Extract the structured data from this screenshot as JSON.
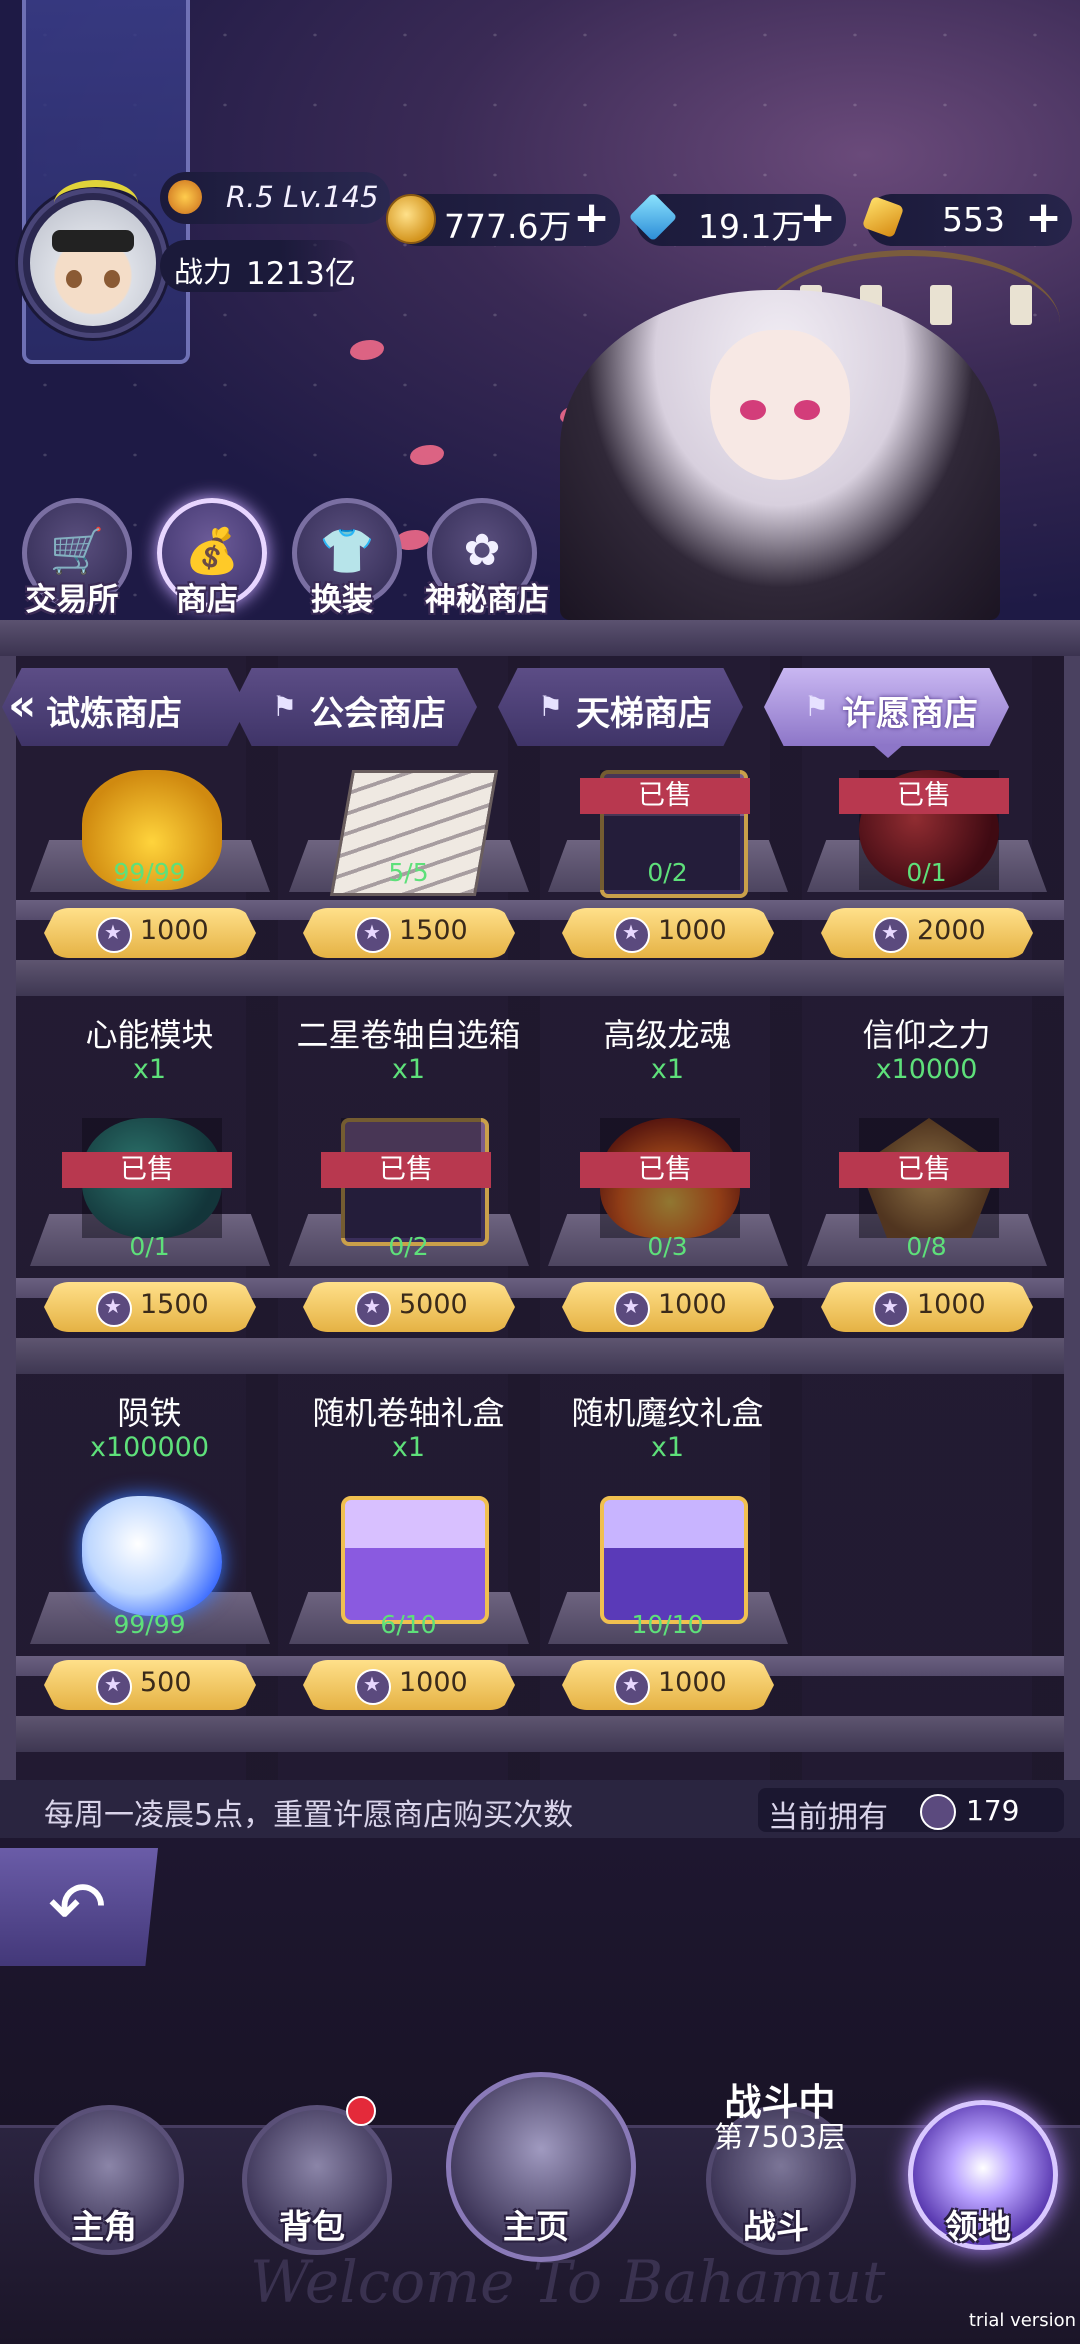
{
  "player": {
    "level": "R.5 Lv.145",
    "power_label": "战力",
    "power_value": "1213亿"
  },
  "currencies": [
    {
      "icon": "gold-coin-icon",
      "value": "777.6万"
    },
    {
      "icon": "blue-diamond-icon",
      "value": "19.1万"
    },
    {
      "icon": "gold-gem-icon",
      "value": "553"
    }
  ],
  "shop_buttons": [
    {
      "label": "交易所",
      "icon": "cart-icon"
    },
    {
      "label": "商店",
      "icon": "money-bag-icon",
      "active": true
    },
    {
      "label": "换装",
      "icon": "shirt-icon"
    },
    {
      "label": "神秘商店",
      "icon": "mystery-bag-icon"
    }
  ],
  "tabs": [
    "试炼商店",
    "公会商店",
    "天梯商店",
    "许愿商店"
  ],
  "sold_label": "已售",
  "rows": [
    {
      "items": [
        {
          "name": "",
          "qty": "",
          "stock": "99/99",
          "price": "1000",
          "sold": false,
          "art": "bag"
        },
        {
          "name": "",
          "qty": "",
          "stock": "5/5",
          "price": "1500",
          "sold": false,
          "art": "cards"
        },
        {
          "name": "",
          "qty": "",
          "stock": "0/2",
          "price": "1000",
          "sold": true,
          "art": "chest"
        },
        {
          "name": "",
          "qty": "",
          "stock": "0/1",
          "price": "2000",
          "sold": true,
          "art": "orb-red"
        }
      ]
    },
    {
      "items": [
        {
          "name": "心能模块",
          "qty": "x1",
          "stock": "0/1",
          "price": "1500",
          "sold": true,
          "art": "orb-teal"
        },
        {
          "name": "二星卷轴自选箱",
          "qty": "x1",
          "stock": "0/2",
          "price": "5000",
          "sold": true,
          "art": "chest"
        },
        {
          "name": "高级龙魂",
          "qty": "x1",
          "stock": "0/3",
          "price": "1000",
          "sold": true,
          "art": "fire"
        },
        {
          "name": "信仰之力",
          "qty": "x10000",
          "stock": "0/8",
          "price": "1000",
          "sold": true,
          "art": "emblem"
        }
      ]
    },
    {
      "items": [
        {
          "name": "陨铁",
          "qty": "x100000",
          "stock": "99/99",
          "price": "500",
          "sold": false,
          "art": "ore"
        },
        {
          "name": "随机卷轴礼盒",
          "qty": "x1",
          "stock": "6/10",
          "price": "1000",
          "sold": false,
          "art": "giftbox"
        },
        {
          "name": "随机魔纹礼盒",
          "qty": "x1",
          "stock": "10/10",
          "price": "1000",
          "sold": false,
          "art": "giftbox2"
        }
      ]
    }
  ],
  "info": {
    "tip": "每周一凌晨5点，重置许愿商店购买次数",
    "own_label": "当前拥有",
    "own_value": "179"
  },
  "nav": [
    {
      "label": "主角"
    },
    {
      "label": "背包"
    },
    {
      "label": "主页"
    },
    {
      "label": "战斗"
    },
    {
      "label": "领地",
      "active": true
    }
  ],
  "battle": {
    "status": "战斗中",
    "floor": "第7503层"
  },
  "watermark": "Welcome To Bahamut",
  "trial": "trial version",
  "colors": {
    "price_gold": "#e5b244",
    "stock_green": "#5ee07a",
    "sold_red": "#b8384f",
    "accent_purple": "#8d76c8"
  }
}
